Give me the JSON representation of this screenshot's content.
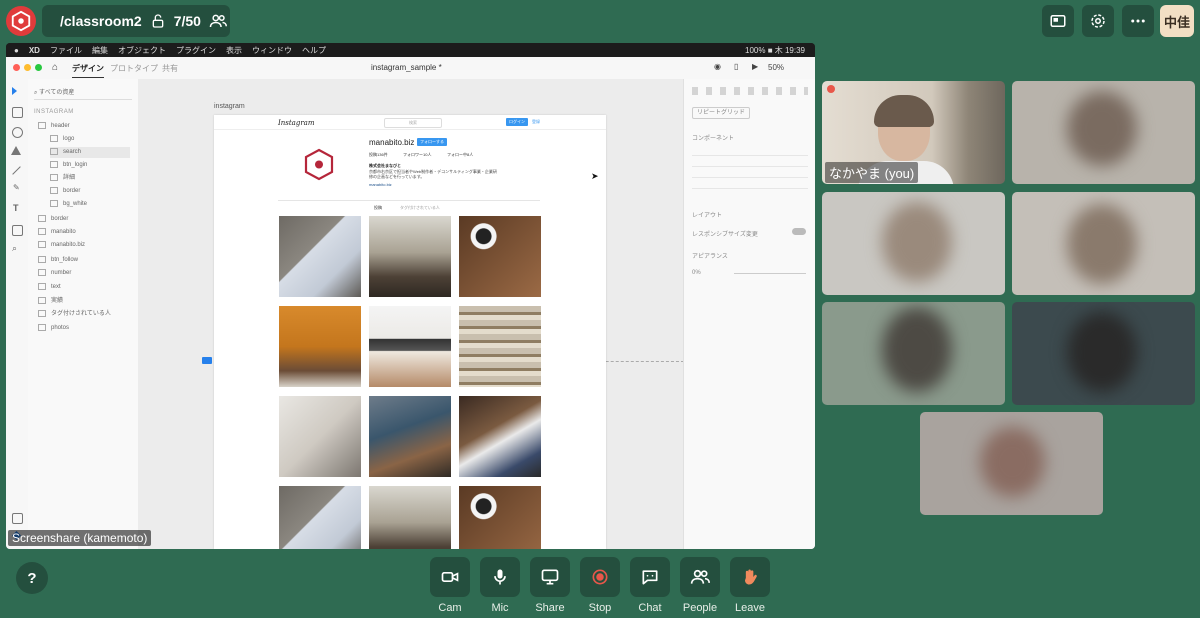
{
  "colors": {
    "bg": "#2f6b52",
    "panel": "#244f3e",
    "accent": "#e03b3b",
    "stop": "#e8574a",
    "leave": "#f08a5d"
  },
  "room": {
    "name": "/classroom2",
    "count": "7/50"
  },
  "user": {
    "initials": "中佳"
  },
  "mac_menu": {
    "items": [
      "XD",
      "ファイル",
      "編集",
      "オブジェクト",
      "プラグイン",
      "表示",
      "ウィンドウ",
      "ヘルプ"
    ],
    "right": "100% ■ 木 19:39"
  },
  "xd": {
    "tab_design": "デザイン",
    "tab_prototype": "プロトタイプ",
    "tab_share": "共有",
    "doc_title": "instagram_sample *",
    "zoom": "50%",
    "search_placeholder": "すべての資産",
    "layers_title": "INSTAGRAM",
    "layers": [
      "header",
      "logo",
      "search",
      "btn_login",
      "詳細",
      "border",
      "bg_white",
      "border",
      "manabito",
      "manabito.biz",
      "btn_follow",
      "number",
      "text",
      "実績",
      "タグ付けされている人",
      "photos"
    ],
    "artboard_label": "instagram",
    "props": {
      "repeat_grid": "リピートグリッド",
      "component": "コンポーネント",
      "layout": "レイアウト",
      "responsive": "レスポンシブサイズ変更",
      "appearance": "アピアランス",
      "opacity": "0%"
    }
  },
  "insta": {
    "logo": "Instagram",
    "search": "検索",
    "login": "ログイン",
    "register": "登録",
    "username": "manabito.biz",
    "follow": "フォローする",
    "stats": [
      "投稿136件",
      "フォロワー10人",
      "フォロー中8人"
    ],
    "company": "株式会社まなびと",
    "bio": "京都市右京区で担当者やWeb制作者・デコンサルティング事業・企業研修の企画などを行っています。",
    "link": "manabito.biz",
    "tab_posts": "投稿",
    "tab_tagged": "タグ付けされている人"
  },
  "screenshare_label": "Screenshare (kamemoto)",
  "you_label": "なかやま (you)",
  "controls": [
    "Cam",
    "Mic",
    "Share",
    "Stop",
    "Chat",
    "People",
    "Leave"
  ],
  "help": "?"
}
